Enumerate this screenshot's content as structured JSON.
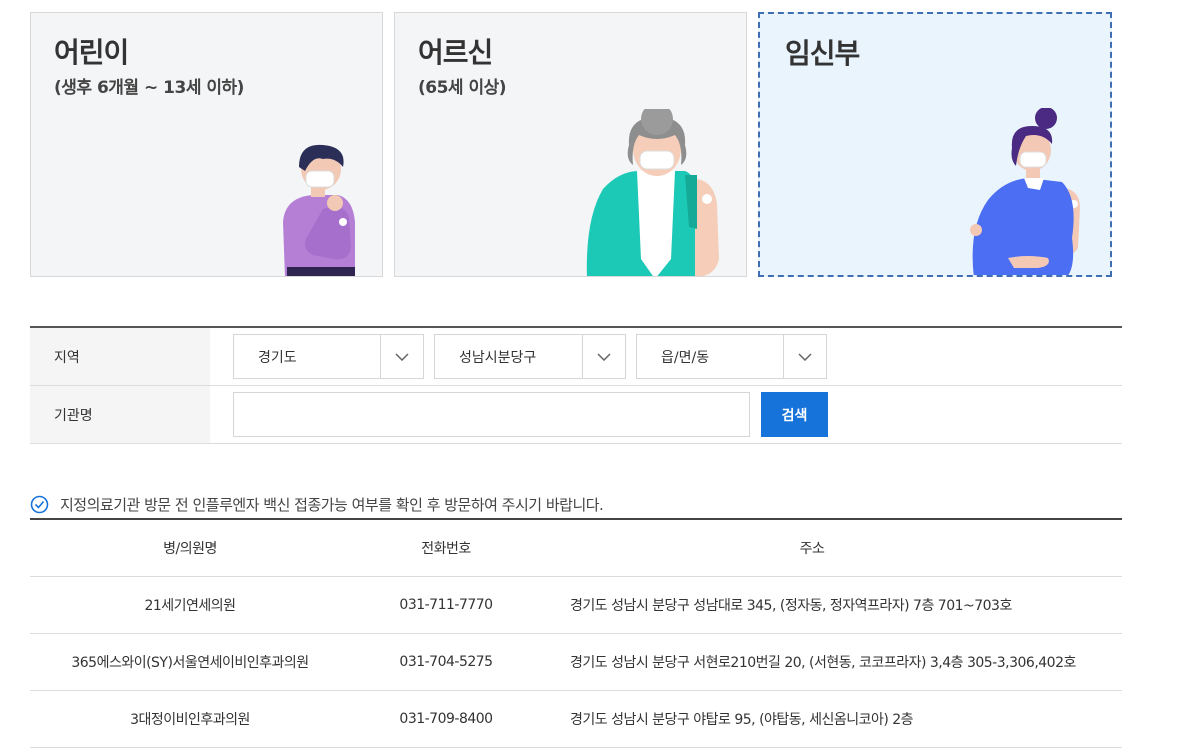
{
  "categories": [
    {
      "title": "어린이",
      "subtitle": "(생후 6개월 ~ 13세 이하)"
    },
    {
      "title": "어르신",
      "subtitle": "(65세 이상)"
    },
    {
      "title": "임신부",
      "subtitle": ""
    }
  ],
  "selected_category": "임신부",
  "form": {
    "region_label": "지역",
    "region_select": "경기도",
    "district_select": "성남시분당구",
    "town_select": "읍/면/동",
    "institution_label": "기관명",
    "institution_value": "",
    "search_button": "검색"
  },
  "notice": "지정의료기관 방문 전 인플루엔자 백신 접종가능 여부를 확인 후 방문하여 주시기 바랍니다.",
  "table": {
    "headers": [
      "병/의원명",
      "전화번호",
      "주소"
    ],
    "rows": [
      [
        "21세기연세의원",
        "031-711-7770",
        "경기도 성남시 분당구 성남대로 345, (정자동, 정자역프라자) 7층 701~703호"
      ],
      [
        "365에스와이(SY)서울연세이비인후과의원",
        "031-704-5275",
        "경기도 성남시 분당구 서현로210번길 20, (서현동, 코코프라자) 3,4층 305-3,306,402호"
      ],
      [
        "3대정이비인후과의원",
        "031-709-8400",
        "경기도 성남시 분당구 야탑로 95, (야탑동, 세신옴니코아) 2층"
      ]
    ]
  },
  "colors": {
    "accent": "#1673d9",
    "selected_border": "#3f6eb5",
    "selected_bg": "#eaf4fc"
  },
  "icons": [
    "chevron-down-icon",
    "check-circle-icon"
  ]
}
